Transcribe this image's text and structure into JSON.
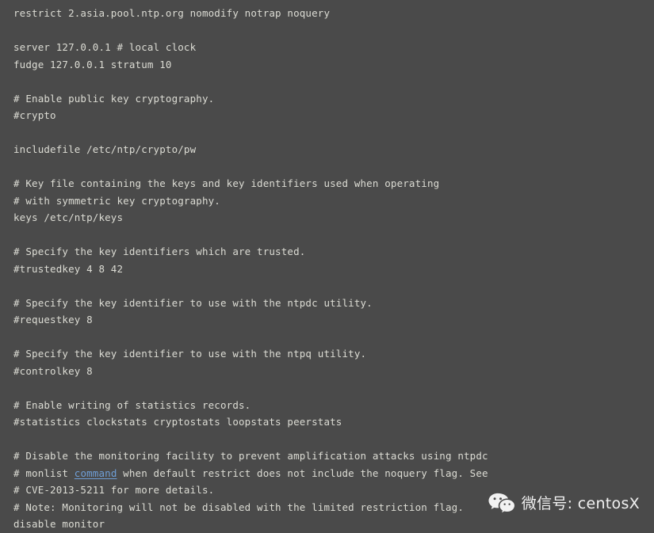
{
  "window": {
    "kind": "text-editor-dark",
    "file": "ntp.conf",
    "background_color": "#4a4a4a",
    "text_color": "#dcdcd4",
    "link_color": "#6f9fd8"
  },
  "code": {
    "lines": [
      {
        "text": "restrict 2.asia.pool.ntp.org nomodify notrap noquery"
      },
      {
        "text": ""
      },
      {
        "text": "server 127.0.0.1 # local clock"
      },
      {
        "text": "fudge 127.0.0.1 stratum 10"
      },
      {
        "text": ""
      },
      {
        "text": "# Enable public key cryptography."
      },
      {
        "text": "#crypto"
      },
      {
        "text": ""
      },
      {
        "text": "includefile /etc/ntp/crypto/pw"
      },
      {
        "text": ""
      },
      {
        "text": "# Key file containing the keys and key identifiers used when operating"
      },
      {
        "text": "# with symmetric key cryptography."
      },
      {
        "text": "keys /etc/ntp/keys"
      },
      {
        "text": ""
      },
      {
        "text": "# Specify the key identifiers which are trusted."
      },
      {
        "text": "#trustedkey 4 8 42"
      },
      {
        "text": ""
      },
      {
        "text": "# Specify the key identifier to use with the ntpdc utility."
      },
      {
        "text": "#requestkey 8"
      },
      {
        "text": ""
      },
      {
        "text": "# Specify the key identifier to use with the ntpq utility."
      },
      {
        "text": "#controlkey 8"
      },
      {
        "text": ""
      },
      {
        "text": "# Enable writing of statistics records."
      },
      {
        "text": "#statistics clockstats cryptostats loopstats peerstats"
      },
      {
        "text": ""
      },
      {
        "text": "# Disable the monitoring facility to prevent amplification attacks using ntpdc"
      },
      {
        "text": "",
        "segments": [
          {
            "type": "plain",
            "text": "# monlist "
          },
          {
            "type": "link",
            "text": "command"
          },
          {
            "type": "plain",
            "text": " when default restrict does not include the noquery flag. See"
          }
        ]
      },
      {
        "text": "# CVE-2013-5211 for more details."
      },
      {
        "text": "# Note: Monitoring will not be disabled with the limited restriction flag."
      },
      {
        "text": "disable monitor"
      }
    ]
  },
  "watermark": {
    "icon": "wechat-icon",
    "text": "微信号: centosX"
  }
}
